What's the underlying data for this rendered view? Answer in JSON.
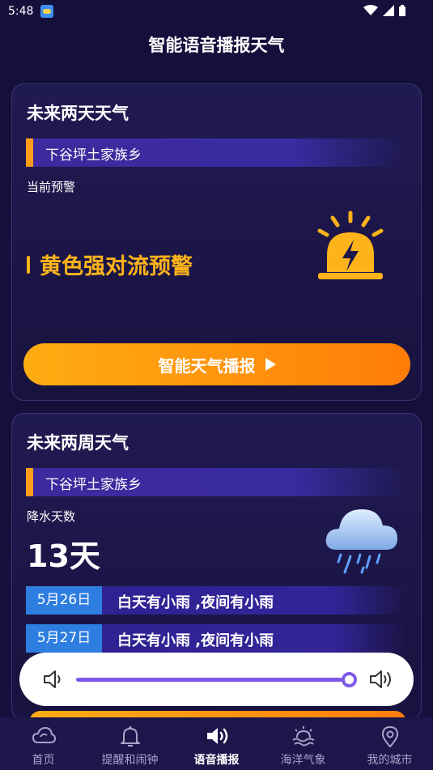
{
  "status_bar": {
    "time": "5:48"
  },
  "header": {
    "title": "智能语音播报天气"
  },
  "two_day_card": {
    "title": "未来两天天气",
    "location": "下谷坪土家族乡",
    "warning_label": "当前预警",
    "warning_text": "黄色强对流预警",
    "button_label": "智能天气播报",
    "warning_color": "#ffb31a"
  },
  "two_week_card": {
    "title": "未来两周天气",
    "location": "下谷坪土家族乡",
    "precip_label": "降水天数",
    "precip_days": "13天",
    "days": [
      {
        "date": "5月26日",
        "desc": "白天有小雨 ,夜间有小雨"
      },
      {
        "date": "5月27日",
        "desc": "白天有小雨 ,夜间有小雨"
      }
    ]
  },
  "volume": {
    "level": 0.98
  },
  "nav": {
    "items": [
      {
        "label": "首页",
        "icon": "cloud-icon"
      },
      {
        "label": "提醒和闹钟",
        "icon": "bell-icon"
      },
      {
        "label": "语音播报",
        "icon": "speaker-icon"
      },
      {
        "label": "海洋气象",
        "icon": "sunrise-sea-icon"
      },
      {
        "label": "我的城市",
        "icon": "location-pin-icon"
      }
    ],
    "active_index": 2
  },
  "colors": {
    "accent_orange": "#ff9c1a",
    "accent_purple": "#7e5be6",
    "date_blue": "#2d7ee0"
  }
}
